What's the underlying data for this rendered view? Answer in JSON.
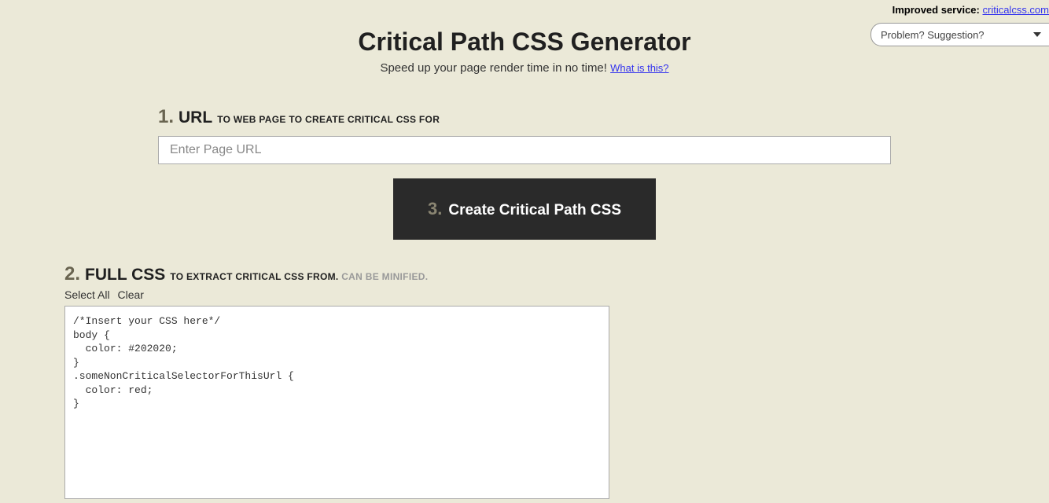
{
  "topbar": {
    "improved_service_label": "Improved service: ",
    "improved_service_link": "criticalcss.com",
    "feedback_placeholder": "Problem? Suggestion?"
  },
  "header": {
    "title": "Critical Path CSS Generator",
    "subtitle": "Speed up your page render time in no time! ",
    "what_is_this": "What is this?"
  },
  "step1": {
    "number": "1.",
    "label": "URL",
    "desc": "TO WEB PAGE TO CREATE CRITICAL CSS FOR",
    "placeholder": "Enter Page URL"
  },
  "step3": {
    "number": "3.",
    "label": "Create Critical Path CSS"
  },
  "step2": {
    "number": "2.",
    "label": "FULL CSS",
    "desc": "TO EXTRACT CRITICAL CSS FROM. ",
    "desc_muted": "CAN BE MINIFIED.",
    "select_all": "Select All",
    "clear": "Clear",
    "css_value": "/*Insert your CSS here*/\nbody {\n  color: #202020;\n}\n.someNonCriticalSelectorForThisUrl {\n  color: red;\n}"
  }
}
